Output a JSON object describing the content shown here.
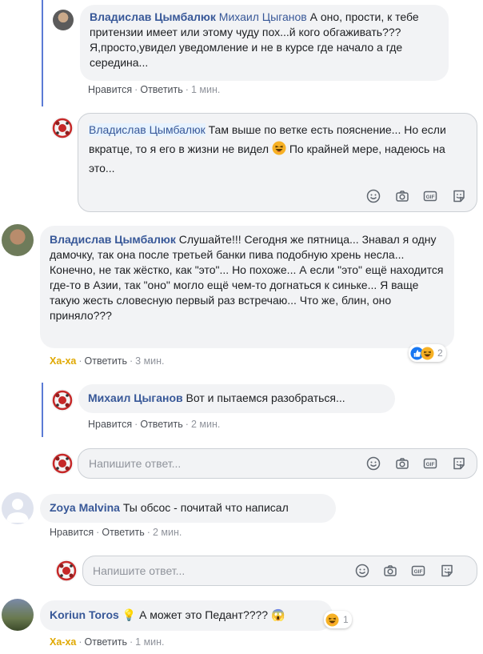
{
  "comments": [
    {
      "author": "Владислав Цымбалюк",
      "mention": "Михаил Цыганов",
      "text": "А оно, прости, к тебе притензии имеет или этому чуду пох...й кого обгаживать??? Я,просто,увидел уведомление и не в курсе где начало а где середина...",
      "actions": {
        "like": "Нравится",
        "reply": "Ответить",
        "time": "1 мин."
      }
    },
    {
      "draft_mention": "Владислав Цымбалюк",
      "draft_text_1": "Там выше по ветке есть пояснение... Но если вкратце, то я его в жизни не видел",
      "draft_text_2": "По крайней мере, надеюсь на это..."
    },
    {
      "author": "Владислав Цымбалюк",
      "text": "Слушайте!!! Сегодня же пятница... Знавал я одну дамочку, так она после третьей банки пива подобную хрень несла... Конечно, не так жёстко, как \"это\"... Но похоже... А если \"это\" ещё находится где-то в Азии, так \"оно\" могло ещё чем-то догнаться к синьке... Я ваще такую жесть словесную первый раз встречаю... Что же, блин, оно приняло???",
      "reaction_count": "2",
      "actions": {
        "like": "Ха-ха",
        "reply": "Ответить",
        "time": "3 мин."
      }
    },
    {
      "author": "Михаил Цыганов",
      "text": "Вот и пытаемся разобраться...",
      "actions": {
        "like": "Нравится",
        "reply": "Ответить",
        "time": "2 мин."
      }
    },
    {
      "author": "Zoya Malvina",
      "text": "Ты обсос - почитай что написал",
      "actions": {
        "like": "Нравится",
        "reply": "Ответить",
        "time": "2 мин."
      }
    },
    {
      "author": "Koriun Toros",
      "text": "А может это Педант????",
      "reaction_count": "1",
      "actions": {
        "like": "Ха-ха",
        "reply": "Ответить",
        "time": "1 мин."
      }
    }
  ],
  "reply_placeholder": "Напишите ответ...",
  "icons": [
    "smile-icon",
    "camera-icon",
    "gif-icon",
    "sticker-icon"
  ],
  "colors": {
    "link": "#385898",
    "haha": "#e0a800",
    "thread": "#5b7bd5"
  }
}
